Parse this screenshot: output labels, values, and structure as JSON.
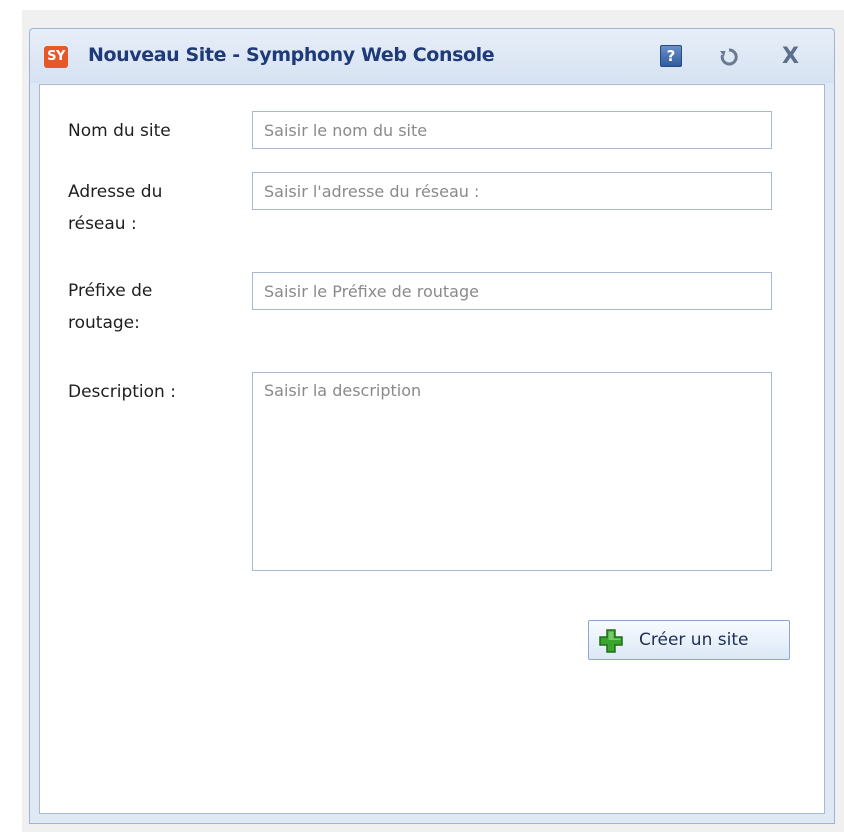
{
  "window": {
    "logo_text": "SY",
    "title": "Nouveau Site - Symphony Web Console",
    "help_icon_text": "?",
    "close_icon_text": "X"
  },
  "form": {
    "site_name": {
      "label": "Nom du site",
      "placeholder": "Saisir le nom du site",
      "value": ""
    },
    "network_address": {
      "label": "Adresse du réseau :",
      "placeholder": "Saisir l'adresse du réseau :",
      "value": ""
    },
    "routing_prefix": {
      "label": "Préfixe de routage:",
      "placeholder": "Saisir le Préfixe de routage",
      "value": ""
    },
    "description": {
      "label": "Description :",
      "placeholder": "Saisir la description",
      "value": ""
    }
  },
  "actions": {
    "create_label": "Créer un site"
  },
  "colors": {
    "title_text": "#1f3a79",
    "logo_bg": "#e8572a",
    "border": "#a6b8d2",
    "plus_icon": "#3aa52d"
  },
  "icons": {
    "logo": "app-logo-icon",
    "help": "help-icon",
    "refresh": "refresh-icon",
    "close": "close-icon",
    "create": "plus-icon"
  }
}
